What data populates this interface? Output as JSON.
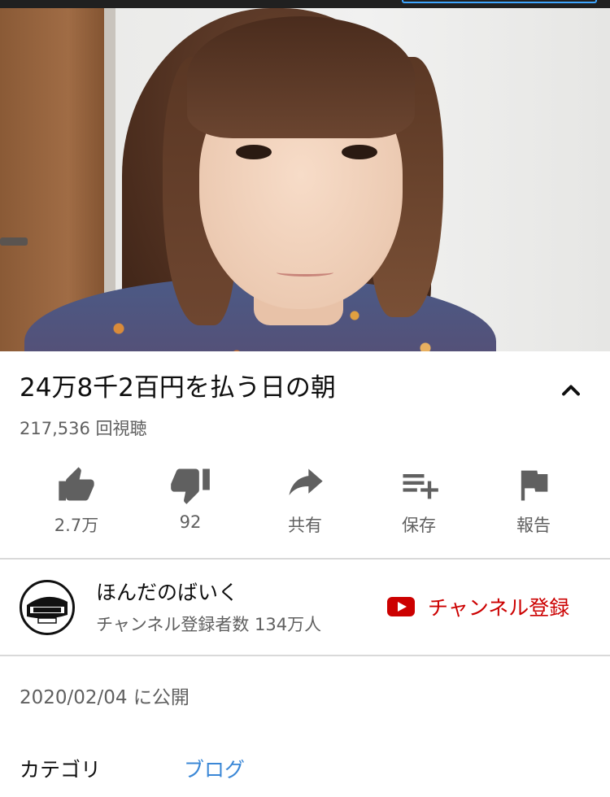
{
  "video": {
    "title": "24万8千2百円を払う日の朝",
    "views": "217,536 回視聴"
  },
  "actions": {
    "like": "2.7万",
    "dislike": "92",
    "share": "共有",
    "save": "保存",
    "report": "報告"
  },
  "channel": {
    "name": "ほんだのばいく",
    "subscribers": "チャンネル登録者数 134万人",
    "subscribe_label": "チャンネル登録"
  },
  "details": {
    "published": "2020/02/04 に公開",
    "category_label": "カテゴリ",
    "category_value": "ブログ"
  },
  "colors": {
    "accent_red": "#cc0000",
    "link_blue": "#3a87d6",
    "secondary_text": "#606060"
  }
}
